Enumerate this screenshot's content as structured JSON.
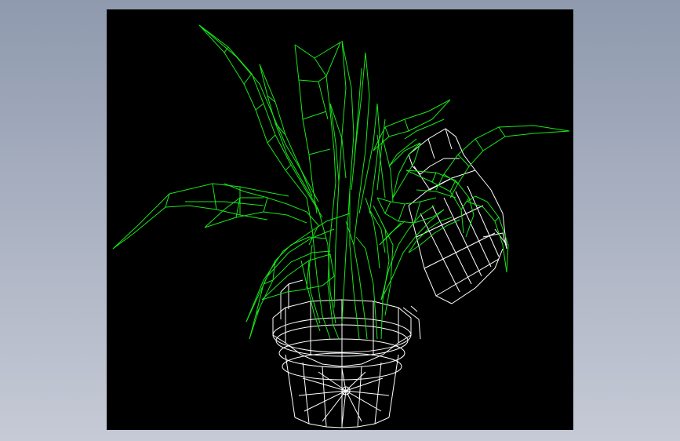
{
  "colors": {
    "background_top": "#8f9aae",
    "background_bottom": "#c6cad6",
    "viewport": "#000000",
    "leaf_wireframe": "#19e619",
    "pot_wireframe": "#ffffff"
  },
  "viewport": {
    "content": "wireframe-3d-model",
    "render_mode": "wireframe"
  }
}
